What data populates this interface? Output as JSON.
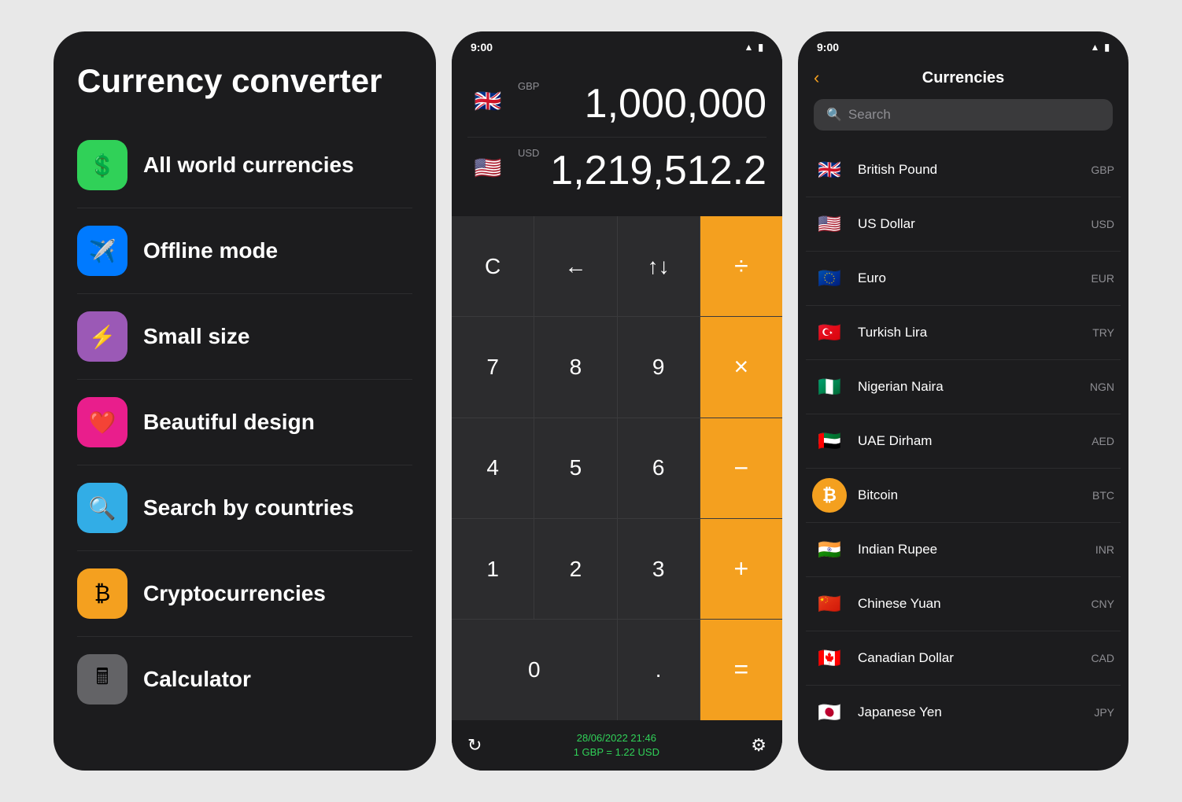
{
  "features_panel": {
    "title": "Currency converter",
    "items": [
      {
        "id": "all-currencies",
        "icon": "💲",
        "icon_color": "green",
        "label": "All world currencies"
      },
      {
        "id": "offline-mode",
        "icon": "✈️",
        "icon_color": "blue",
        "label": "Offline mode"
      },
      {
        "id": "small-size",
        "icon": "⚡",
        "icon_color": "purple",
        "label": "Small size"
      },
      {
        "id": "beautiful-design",
        "icon": "❤️",
        "icon_color": "pink",
        "label": "Beautiful design"
      },
      {
        "id": "search-countries",
        "icon": "🔍",
        "icon_color": "cyan",
        "label": "Search by countries"
      },
      {
        "id": "cryptocurrencies",
        "icon": "₿",
        "icon_color": "orange",
        "label": "Cryptocurrencies"
      },
      {
        "id": "calculator",
        "icon": "🖩",
        "icon_color": "gray",
        "label": "Calculator"
      }
    ]
  },
  "calculator_panel": {
    "status_time": "9:00",
    "from_flag": "🇬🇧",
    "from_code": "GBP",
    "from_amount": "1,000,000",
    "to_flag": "🇺🇸",
    "to_code": "USD",
    "to_amount": "1,219,512.2",
    "keys": [
      {
        "label": "C",
        "type": "normal"
      },
      {
        "label": "←",
        "type": "normal"
      },
      {
        "label": "↑↓",
        "type": "normal"
      },
      {
        "label": "÷",
        "type": "orange"
      },
      {
        "label": "7",
        "type": "normal"
      },
      {
        "label": "8",
        "type": "normal"
      },
      {
        "label": "9",
        "type": "normal"
      },
      {
        "label": "×",
        "type": "orange"
      },
      {
        "label": "4",
        "type": "normal"
      },
      {
        "label": "5",
        "type": "normal"
      },
      {
        "label": "6",
        "type": "normal"
      },
      {
        "label": "−",
        "type": "orange"
      },
      {
        "label": "1",
        "type": "normal"
      },
      {
        "label": "2",
        "type": "normal"
      },
      {
        "label": "3",
        "type": "normal"
      },
      {
        "label": "+",
        "type": "orange"
      },
      {
        "label": "0",
        "type": "zero"
      },
      {
        "label": ".",
        "type": "normal"
      },
      {
        "label": "=",
        "type": "orange"
      }
    ],
    "footer_date": "28/06/2022 21:46",
    "footer_rate": "1 GBP = 1.22 USD"
  },
  "currencies_panel": {
    "status_time": "9:00",
    "header_title": "Currencies",
    "back_label": "‹",
    "search_placeholder": "Search",
    "currencies": [
      {
        "flag": "🇬🇧",
        "name": "British Pound",
        "code": "GBP",
        "bg": "#012169"
      },
      {
        "flag": "🇺🇸",
        "name": "US Dollar",
        "code": "USD",
        "bg": "#3c3b6e"
      },
      {
        "flag": "🇪🇺",
        "name": "Euro",
        "code": "EUR",
        "bg": "#003399"
      },
      {
        "flag": "🇹🇷",
        "name": "Turkish Lira",
        "code": "TRY",
        "bg": "#e30a17"
      },
      {
        "flag": "🇳🇬",
        "name": "Nigerian Naira",
        "code": "NGN",
        "bg": "#008751"
      },
      {
        "flag": "🇦🇪",
        "name": "UAE Dirham",
        "code": "AED",
        "bg": "#00732f"
      },
      {
        "flag": "₿",
        "name": "Bitcoin",
        "code": "BTC",
        "bg": "#f4a01f",
        "isCrypto": true
      },
      {
        "flag": "🇮🇳",
        "name": "Indian Rupee",
        "code": "INR",
        "bg": "#ff9933"
      },
      {
        "flag": "🇨🇳",
        "name": "Chinese Yuan",
        "code": "CNY",
        "bg": "#de2910"
      },
      {
        "flag": "🇨🇦",
        "name": "Canadian Dollar",
        "code": "CAD",
        "bg": "#ff0000"
      },
      {
        "flag": "🇯🇵",
        "name": "Japanese Yen",
        "code": "JPY",
        "bg": "#bc002d"
      }
    ]
  }
}
